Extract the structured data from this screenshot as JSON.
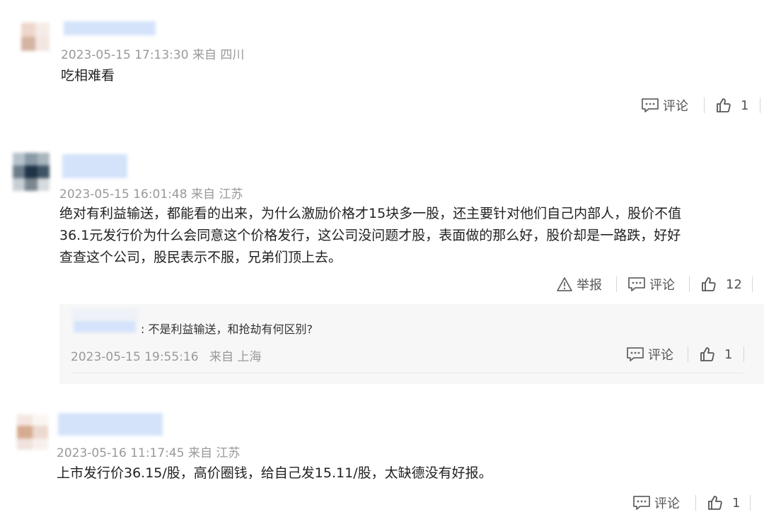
{
  "comments": [
    {
      "time": "2023-05-15 17:13:30",
      "location_prefix": "来自",
      "location": "四川",
      "text": "吃相难看",
      "comment_label": "评论",
      "like_count": "1"
    },
    {
      "time": "2023-05-15 16:01:48",
      "location_prefix": "来自",
      "location": "江苏",
      "text_lines": [
        "绝对有利益输送，都能看的出来，为什么激励价格才15块多一股，还主要针对他们自己内部人，股价不值",
        "36.1元发行价为什么会同意这个价格发行，这公司没问题才股，表面做的那么好，股价却是一路跌，好好",
        "查查这个公司，股民表示不服，兄弟们顶上去。"
      ],
      "report_label": "举报",
      "comment_label": "评论",
      "like_count": "12",
      "reply": {
        "text": ": 不是利益输送，和抢劫有何区别?",
        "time": "2023-05-15 19:55:16",
        "location_prefix": "来自",
        "location": "上海",
        "comment_label": "评论",
        "like_count": "1"
      }
    },
    {
      "time": "2023-05-16 11:17:45",
      "location_prefix": "来自",
      "location": "江苏",
      "text": "上市发行价36.15/股，高价圈钱，给自己发15.11/股，太缺德没有好报。",
      "comment_label": "评论",
      "like_count": "1"
    }
  ],
  "colors": {
    "background": "#ffffff",
    "meta_text": "#999999",
    "reply_background": "#f7f7f7",
    "name_mosaic": "#d4e3fa"
  }
}
